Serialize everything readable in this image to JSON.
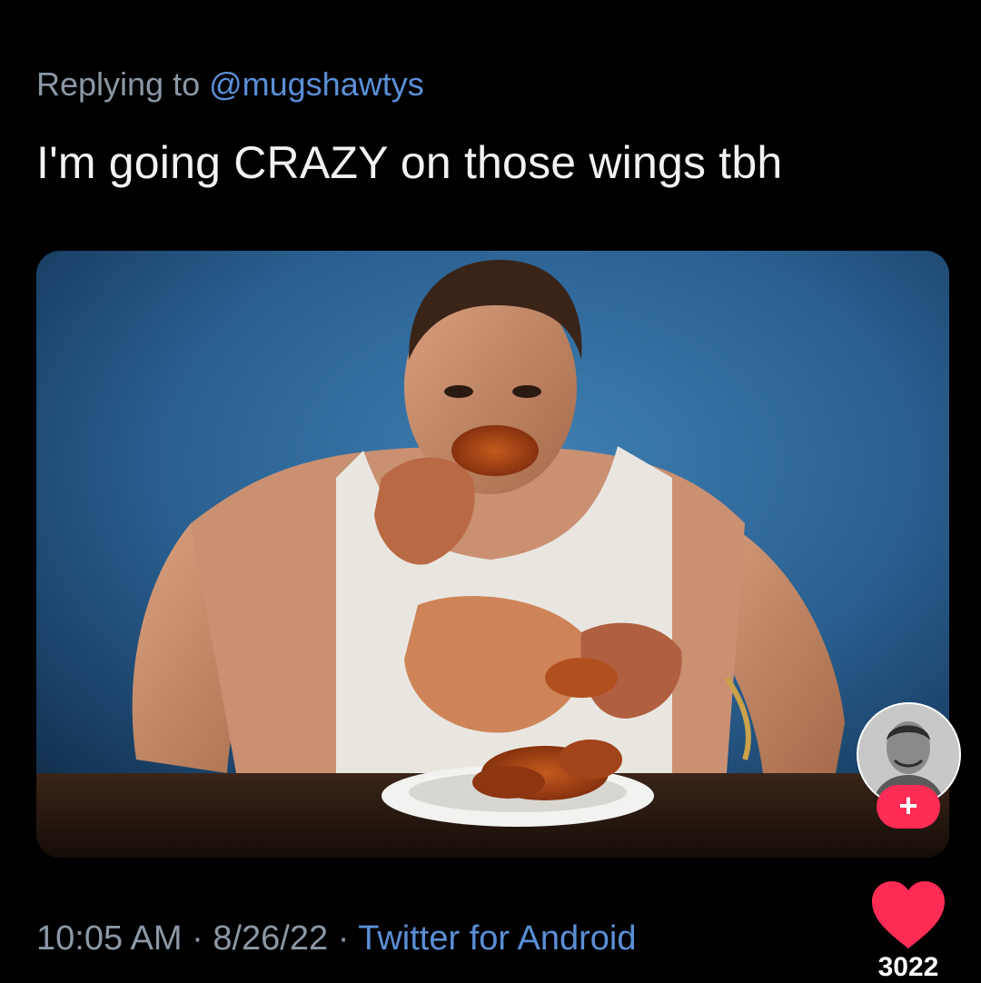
{
  "tweet": {
    "replying_prefix": "Replying to ",
    "replying_handle": "@mugshawtys",
    "text": "I'm going CRAZY on those wings tbh",
    "time": "10:05 AM",
    "separator": " · ",
    "date": "8/26/22",
    "source": "Twitter for Android"
  },
  "overlay": {
    "follow_label": "+",
    "like_count": "3022",
    "like_color": "#fe2c55",
    "follow_color": "#ff2c55",
    "avatar_icon": "profile-avatar",
    "heart_icon": "heart-icon"
  },
  "colors": {
    "background": "#000000",
    "muted_text": "#8b98a5",
    "link": "#5b8fd6",
    "photo_backdrop": "#2a5d8c"
  }
}
